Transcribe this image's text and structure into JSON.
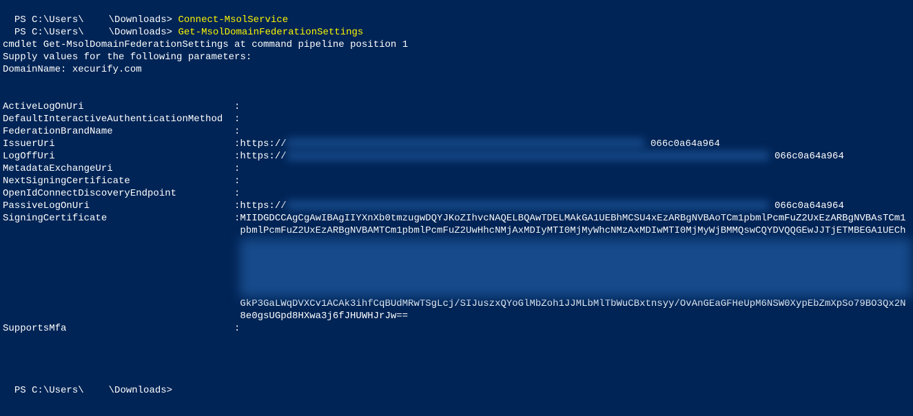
{
  "prompt1": {
    "prefix": "PS C:\\Users\\",
    "redacted_user_width": 36,
    "suffix": "\\Downloads> ",
    "command": "Connect-MsolService"
  },
  "prompt2": {
    "prefix": "PS C:\\Users\\",
    "redacted_user_width": 36,
    "suffix": "\\Downloads> ",
    "command": "Get-MsolDomainFederationSettings"
  },
  "interactive": {
    "line1": "cmdlet Get-MsolDomainFederationSettings at command pipeline position 1",
    "line2": "Supply values for the following parameters:",
    "line3": "DomainName: xecurify.com"
  },
  "rows": [
    {
      "key": "ActiveLogOnUri",
      "value": ""
    },
    {
      "key": "DefaultInteractiveAuthenticationMethod",
      "value": ""
    },
    {
      "key": "FederationBrandName",
      "value": ""
    },
    {
      "key": "IssuerUri",
      "prefix": "https://",
      "blur_width": 520,
      "tail": "066c0a64a964"
    },
    {
      "key": "LogOffUri",
      "prefix": "https://",
      "blur_width": 700,
      "tail": "066c0a64a964"
    },
    {
      "key": "MetadataExchangeUri",
      "value": ""
    },
    {
      "key": "NextSigningCertificate",
      "value": ""
    },
    {
      "key": "OpenIdConnectDiscoveryEndpoint",
      "value": ""
    },
    {
      "key": "PassiveLogOnUri",
      "prefix": "https://",
      "blur_width": 700,
      "tail": "066c0a64a964"
    }
  ],
  "signing_cert": {
    "key": "SigningCertificate",
    "line1": "MIIDGDCCAgCgAwIBAgIIYXnXb0tmzugwDQYJKoZIhvcNAQELBQAwTDELMAkGA1UEBhMCSU4xEzARBgNVBAoTCm1pbmlPcmFuZ2UxEzARBgNVBAsTCm1",
    "line2": "pbmlPcmFuZ2UxEzARBgNVBAMTCm1pbmlPcmFuZ2UwHhcNMjAxMDIyMTI0MjMyWhcNMzAxMDIwMTI0MjMyWjBMMQswCQYDVQQGEwJJTjETMBEGA1UECh",
    "line_end1": "GkP3GaLWqDVXCv1ACAk3ihfCqBUdMRwTSgLcj/SIJuszxQYoGlMbZoh1JJMLbMlTbWuCBxtnsyy/OvAnGEaGFHeUpM6NSW0XypEbZmXpSo79BO3Qx2N",
    "line_end2": "8e0gsUGpd8HXwa3j6fJHUWHJrJw=="
  },
  "supports_mfa": {
    "key": "SupportsMfa",
    "value": ""
  },
  "final_prompt": {
    "prefix": "PS C:\\Users\\",
    "redacted_user_width": 36,
    "suffix": "\\Downloads>"
  }
}
